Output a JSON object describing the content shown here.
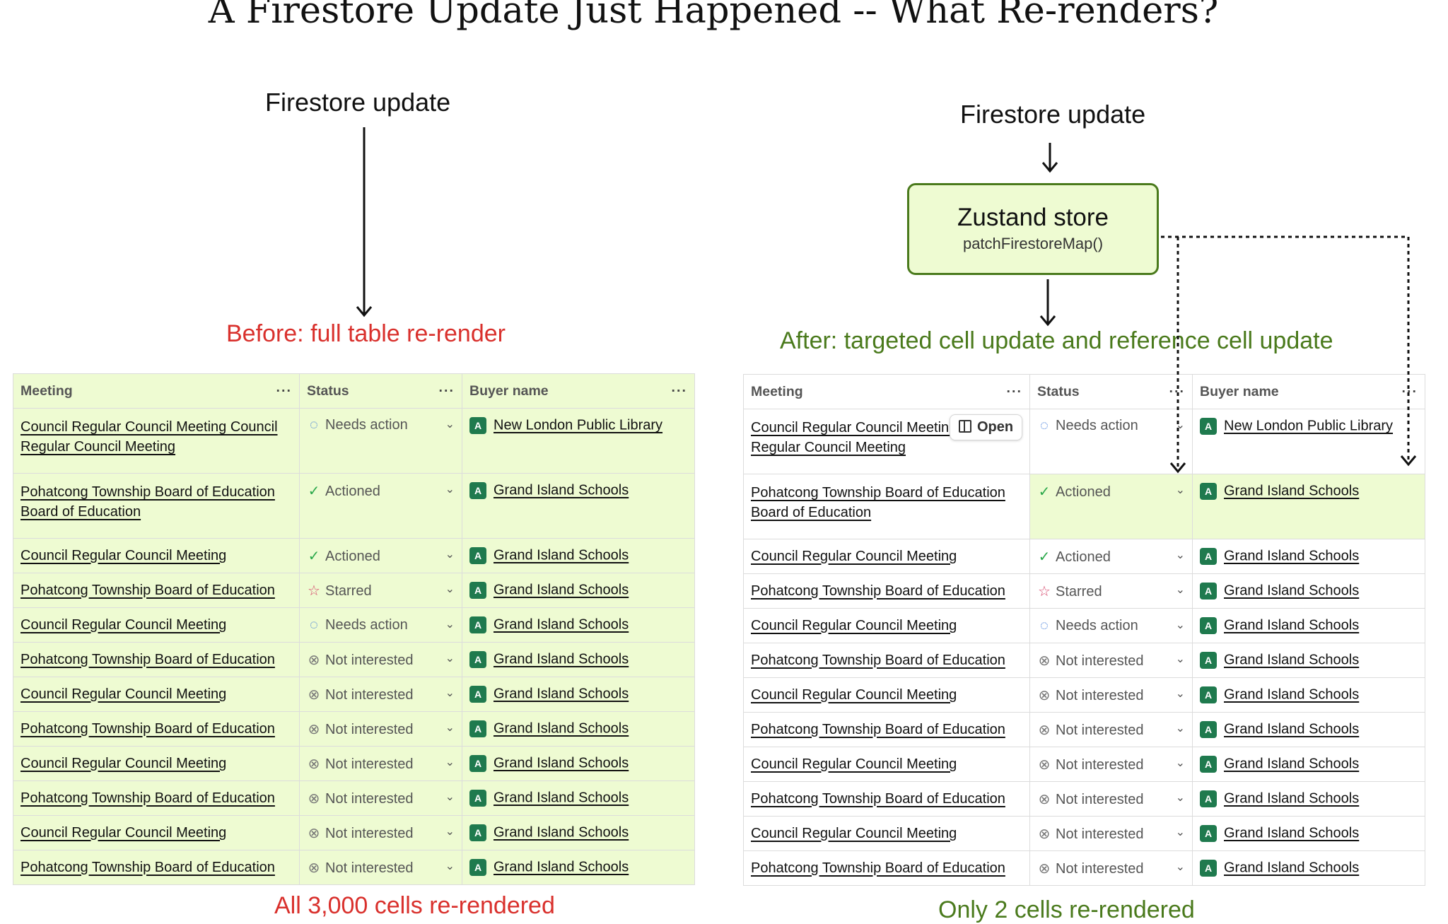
{
  "title": "A Firestore Update Just Happened -- What Re-renders?",
  "left": {
    "source_label": "Firestore update",
    "heading": "Before: full table re-render",
    "caption": "All 3,000 cells re-rendered"
  },
  "right": {
    "source_label": "Firestore update",
    "store_name": "Zustand store",
    "store_fn": "patchFirestoreMap()",
    "heading": "After: targeted cell update and reference cell update",
    "caption": "Only 2 cells re-rendered",
    "open_button": "Open"
  },
  "columns": [
    "Meeting",
    "Status",
    "Buyer name"
  ],
  "column_menu": "···",
  "avatar_letter": "A",
  "rows": [
    {
      "meeting": "Council Regular Council Meeting Council Regular Council Meeting",
      "status": "Needs action",
      "icon": "needs-action-icon",
      "buyer": "New London Public Library"
    },
    {
      "meeting": "Pohatcong Township Board of Education Board of Education",
      "status": "Actioned",
      "icon": "actioned-icon",
      "buyer": "Grand Island Schools"
    },
    {
      "meeting": "Council Regular Council Meeting",
      "status": "Actioned",
      "icon": "actioned-icon",
      "buyer": "Grand Island Schools"
    },
    {
      "meeting": "Pohatcong Township Board of Education",
      "status": "Starred",
      "icon": "starred-icon",
      "buyer": "Grand Island Schools"
    },
    {
      "meeting": "Council Regular Council Meeting",
      "status": "Needs action",
      "icon": "needs-action-icon",
      "buyer": "Grand Island Schools"
    },
    {
      "meeting": "Pohatcong Township Board of Education",
      "status": "Not interested",
      "icon": "not-interested-icon",
      "buyer": "Grand Island Schools"
    },
    {
      "meeting": "Council Regular Council Meeting",
      "status": "Not interested",
      "icon": "not-interested-icon",
      "buyer": "Grand Island Schools"
    },
    {
      "meeting": "Pohatcong Township Board of Education",
      "status": "Not interested",
      "icon": "not-interested-icon",
      "buyer": "Grand Island Schools"
    },
    {
      "meeting": "Council Regular Council Meeting",
      "status": "Not interested",
      "icon": "not-interested-icon",
      "buyer": "Grand Island Schools"
    },
    {
      "meeting": "Pohatcong Township Board of Education",
      "status": "Not interested",
      "icon": "not-interested-icon",
      "buyer": "Grand Island Schools"
    },
    {
      "meeting": "Council Regular Council Meeting",
      "status": "Not interested",
      "icon": "not-interested-icon",
      "buyer": "Grand Island Schools"
    },
    {
      "meeting": "Pohatcong Township Board of Education",
      "status": "Not interested",
      "icon": "not-interested-icon",
      "buyer": "Grand Island Schools"
    }
  ],
  "colors": {
    "highlight": "#eefbd2",
    "red": "#d9302c",
    "green": "#4a7a1c"
  }
}
